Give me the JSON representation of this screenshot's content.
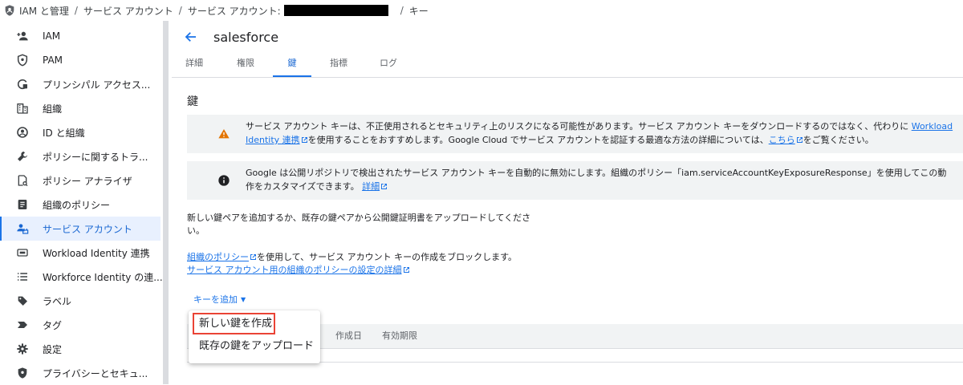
{
  "breadcrumb": {
    "items": [
      "IAM と管理",
      "サービス アカウント",
      "サービス アカウント:",
      "キー"
    ],
    "separator": "/"
  },
  "sidebar": {
    "items": [
      {
        "label": "IAM",
        "icon": "person-add-icon"
      },
      {
        "label": "PAM",
        "icon": "shield-icon"
      },
      {
        "label": "プリンシパル アクセス...",
        "icon": "principal-access-icon"
      },
      {
        "label": "組織",
        "icon": "organization-icon"
      },
      {
        "label": "ID と組織",
        "icon": "account-circle-icon"
      },
      {
        "label": "ポリシーに関するトラ...",
        "icon": "wrench-icon"
      },
      {
        "label": "ポリシー アナライザ",
        "icon": "analyzer-icon"
      },
      {
        "label": "組織のポリシー",
        "icon": "policy-doc-icon"
      },
      {
        "label": "サービス アカウント",
        "icon": "service-account-icon",
        "active": true
      },
      {
        "label": "Workload Identity 連携",
        "icon": "workload-identity-icon"
      },
      {
        "label": "Workforce Identity の連...",
        "icon": "list-icon"
      },
      {
        "label": "ラベル",
        "icon": "label-icon"
      },
      {
        "label": "タグ",
        "icon": "tag-icon"
      },
      {
        "label": "設定",
        "icon": "gear-icon"
      },
      {
        "label": "プライバシーとセキュ...",
        "icon": "privacy-shield-icon"
      }
    ]
  },
  "page": {
    "title": "salesforce"
  },
  "tabs": [
    {
      "label": "詳細"
    },
    {
      "label": "権限"
    },
    {
      "label": "鍵",
      "active": true
    },
    {
      "label": "指標"
    },
    {
      "label": "ログ"
    }
  ],
  "keys_section": {
    "title": "鍵",
    "warning": {
      "before": "サービス アカウント キーは、不正使用されるとセキュリティ上のリスクになる可能性があります。サービス アカウント キーをダウンロードするのではなく、代わりに ",
      "link1": "Workload Identity 連携",
      "middle": "を使用することをおすすめします。Google Cloud でサービス アカウントを認証する最適な方法の詳細については、",
      "link2": "こちら",
      "after": "をご覧ください。"
    },
    "info": {
      "text": "Google は公開リポジトリで検出されたサービス アカウント キーを自動的に無効にします。組織のポリシー「iam.serviceAccountKeyExposureResponse」を使用してこの動作をカスタマイズできます。",
      "link": "詳細"
    },
    "intro": "新しい鍵ペアを追加するか、既存の鍵ペアから公開鍵証明書をアップロードしてください。",
    "policy": {
      "link1": "組織のポリシー",
      "text": "を使用して、サービス アカウント キーの作成をブロックします。",
      "link2": "サービス アカウント用の組織のポリシーの設定の詳細"
    },
    "add_key_label": "キーを追加",
    "table_headers": [
      "作成日",
      "有効期限"
    ],
    "menu": {
      "items": [
        "新しい鍵を作成",
        "既存の鍵をアップロード"
      ]
    }
  },
  "colors": {
    "accent": "#1a73e8",
    "warning": "#e37400",
    "highlight": "#ea4335",
    "active_bg": "#e8f0fe"
  }
}
